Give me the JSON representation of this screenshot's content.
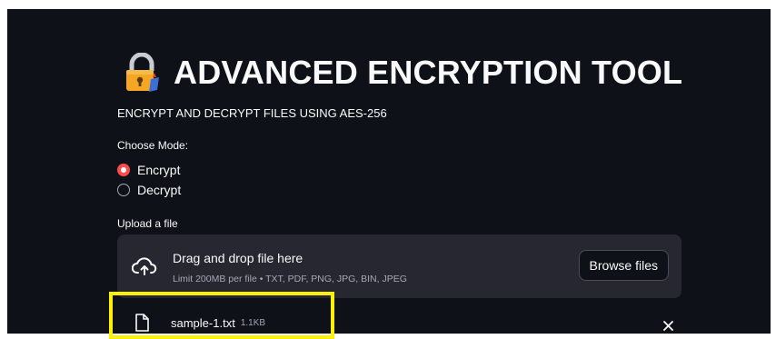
{
  "header": {
    "title": "ADVANCED ENCRYPTION TOOL",
    "icon": "lock-icon",
    "subtitle": "ENCRYPT AND DECRYPT FILES USING AES-256"
  },
  "mode": {
    "label": "Choose Mode:",
    "options": [
      {
        "label": "Encrypt",
        "selected": true
      },
      {
        "label": "Decrypt",
        "selected": false
      }
    ]
  },
  "uploader": {
    "label": "Upload a file",
    "icon": "cloud-upload-icon",
    "drop_text": "Drag and drop file here",
    "hint": "Limit 200MB per file • TXT, PDF, PNG, JPG, BIN, JPEG",
    "browse_label": "Browse files"
  },
  "uploaded_file": {
    "icon": "file-icon",
    "name": "sample-1.txt",
    "size": "1.1KB",
    "remove_icon": "close-icon"
  },
  "colors": {
    "background": "#0e1117",
    "accent": "#ff4b4b",
    "dropzone": "#262730",
    "highlight": "#fff200"
  }
}
